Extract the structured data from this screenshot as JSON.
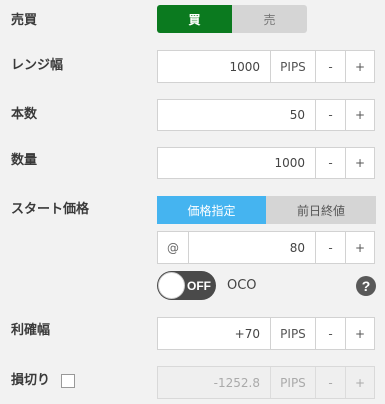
{
  "side": {
    "label": "売買",
    "buy": "買",
    "sell": "売",
    "buy_color": "#0b7a1f",
    "sell_color": "#d5d5d5"
  },
  "range_width": {
    "label": "レンジ幅",
    "value": "1000",
    "unit": "PIPS",
    "minus": "-",
    "plus": "+"
  },
  "count": {
    "label": "本数",
    "value": "50",
    "minus": "-",
    "plus": "+"
  },
  "quantity": {
    "label": "数量",
    "value": "1000",
    "minus": "-",
    "plus": "+"
  },
  "start_price": {
    "label": "スタート価格",
    "tab_price": "価格指定",
    "tab_prev_close": "前日終値",
    "active_color": "#45b4f0",
    "at_symbol": "@",
    "value": "80",
    "minus": "-",
    "plus": "+"
  },
  "oco": {
    "toggle_label": "OFF",
    "label": "OCO",
    "help": "?"
  },
  "take_profit": {
    "label": "利確幅",
    "value": "+70",
    "unit": "PIPS",
    "minus": "-",
    "plus": "+"
  },
  "stop_loss": {
    "label": "損切り",
    "value": "-1252.8",
    "unit": "PIPS",
    "minus": "-",
    "plus": "+"
  }
}
